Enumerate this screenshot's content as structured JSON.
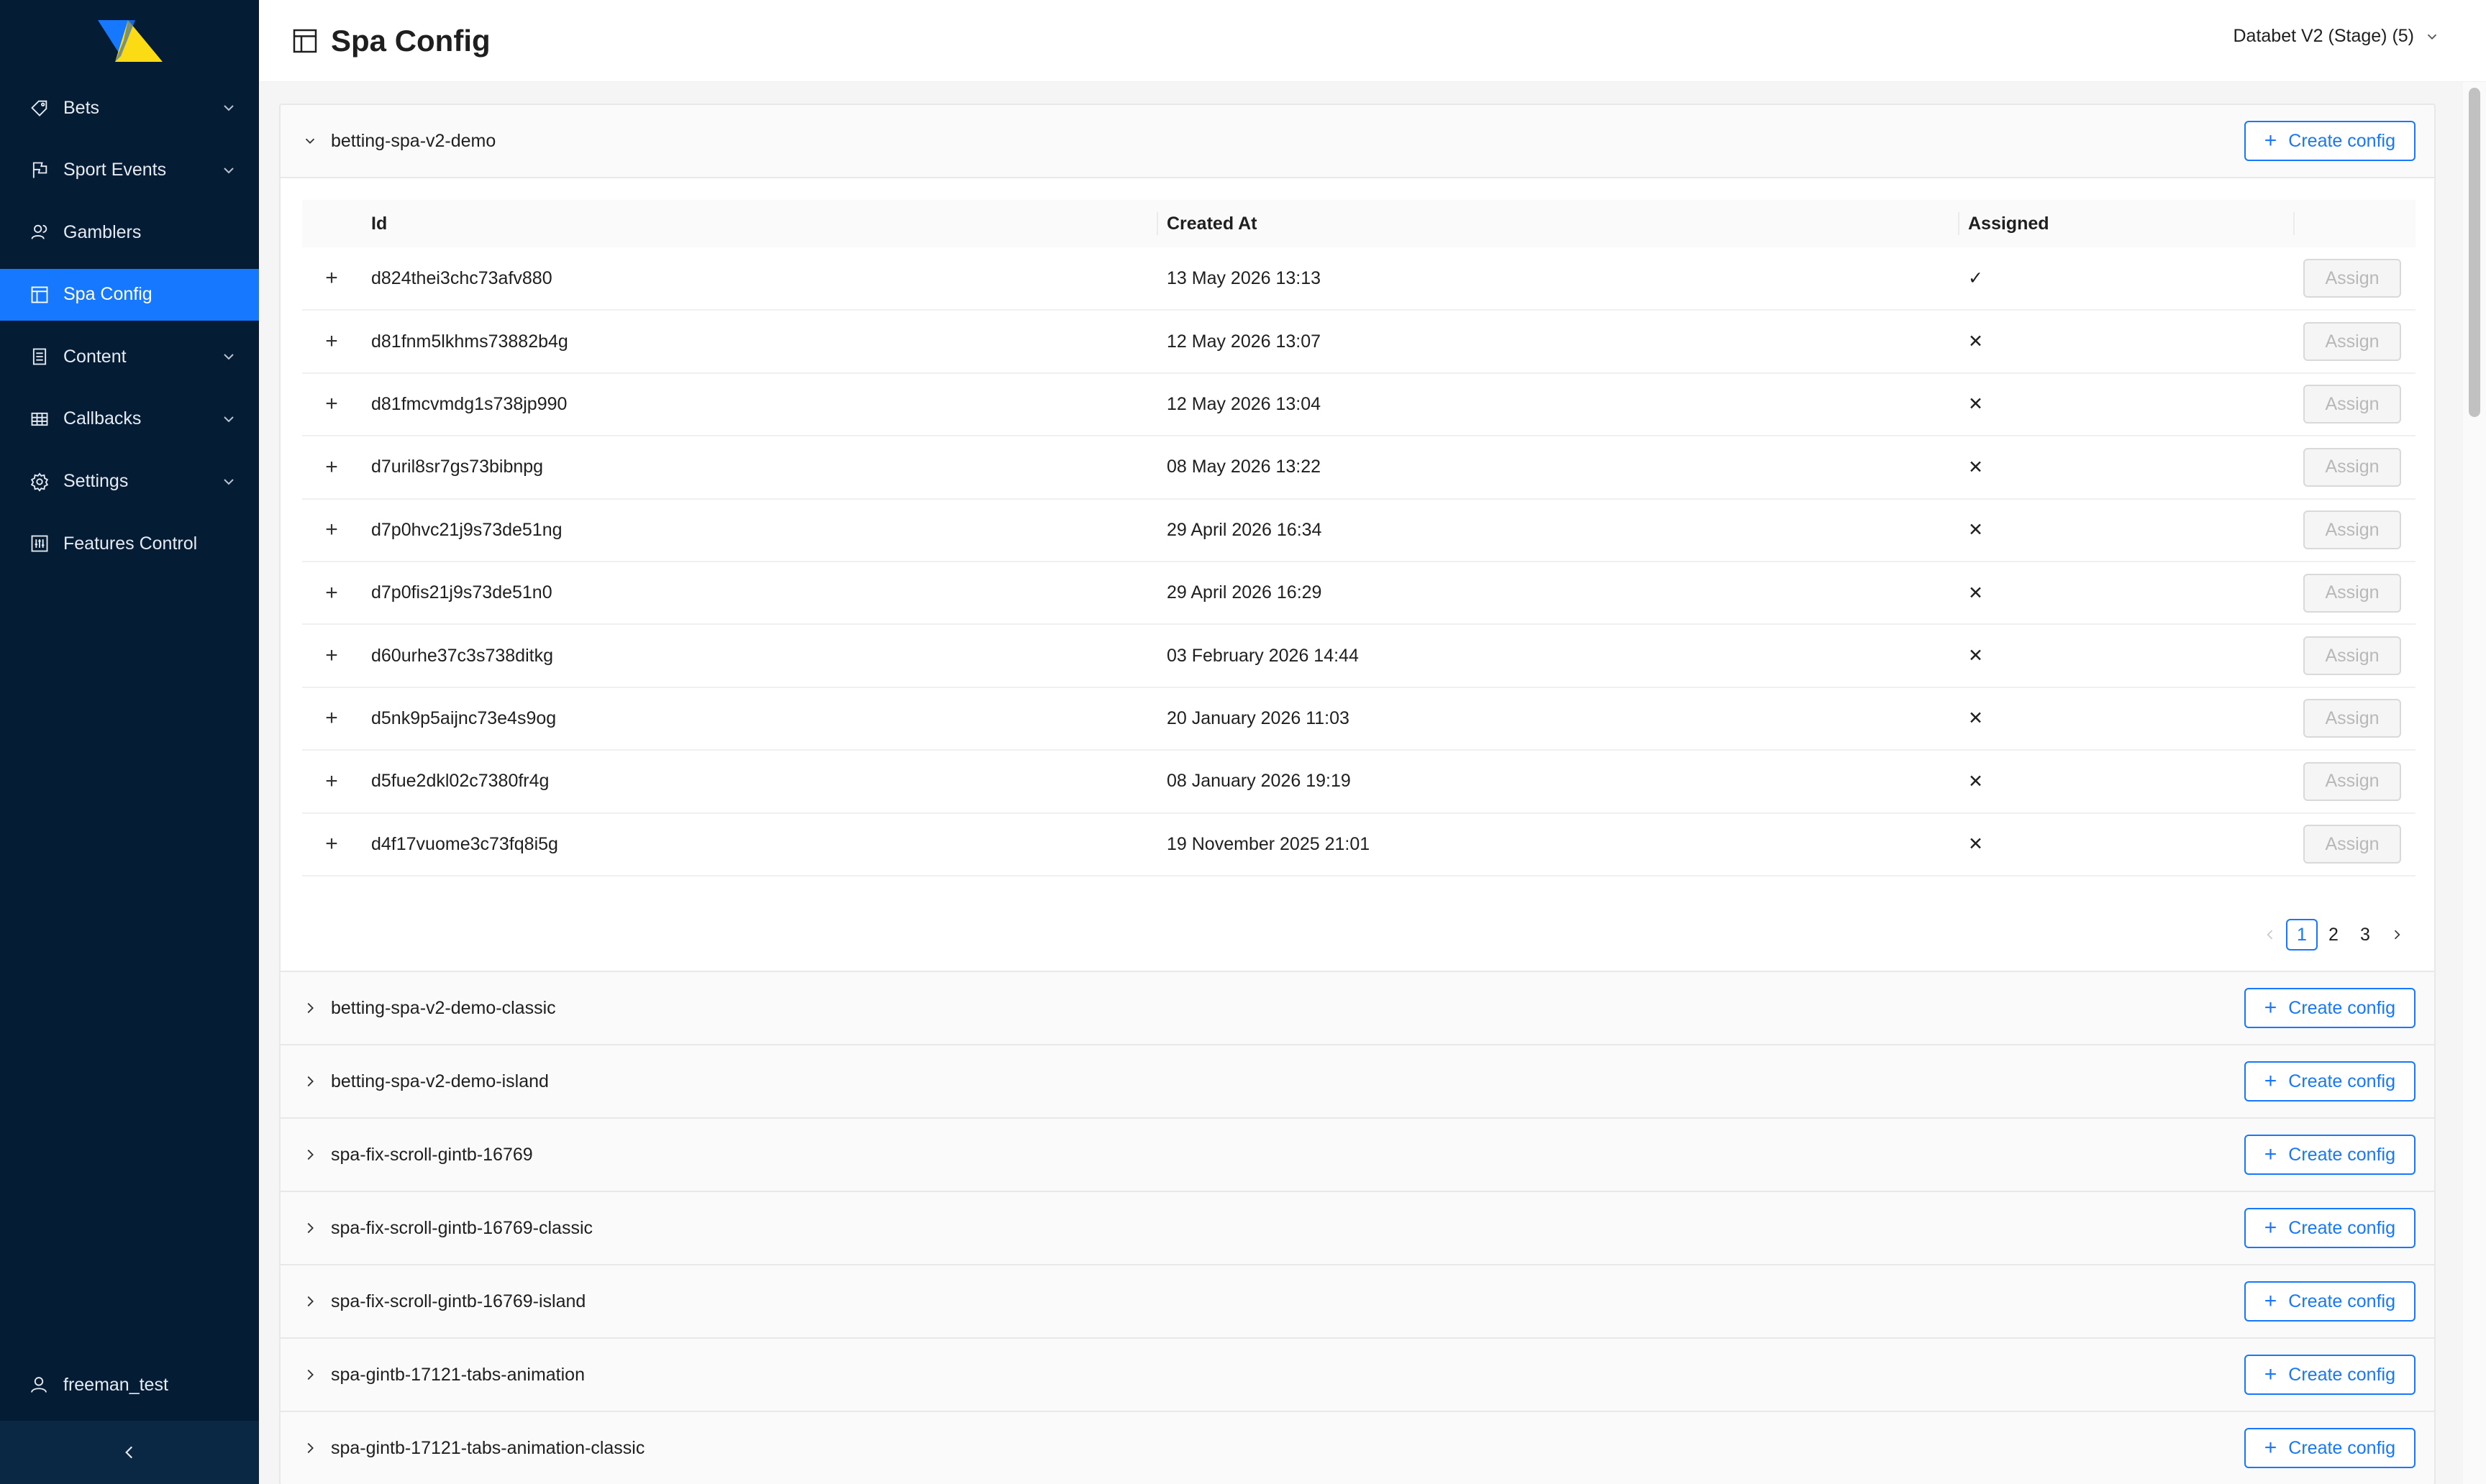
{
  "app": {
    "title": "Spa Config"
  },
  "sidebar": {
    "items": [
      {
        "label": "Bets",
        "icon": "tag-icon",
        "has_submenu": true,
        "active": false
      },
      {
        "label": "Sport Events",
        "icon": "flag-icon",
        "has_submenu": true,
        "active": false
      },
      {
        "label": "Gamblers",
        "icon": "users-icon",
        "has_submenu": false,
        "active": false
      },
      {
        "label": "Spa Config",
        "icon": "layout-icon",
        "has_submenu": false,
        "active": true
      },
      {
        "label": "Content",
        "icon": "document-icon",
        "has_submenu": true,
        "active": false
      },
      {
        "label": "Callbacks",
        "icon": "table-icon",
        "has_submenu": true,
        "active": false
      },
      {
        "label": "Settings",
        "icon": "gear-icon",
        "has_submenu": true,
        "active": false
      },
      {
        "label": "Features Control",
        "icon": "control-icon",
        "has_submenu": false,
        "active": false
      }
    ],
    "user": "freeman_test"
  },
  "header": {
    "title": "Spa Config",
    "project_select": "Databet V2 (Stage) (5)"
  },
  "colors": {
    "sidebar_bg": "#051c35",
    "accent": "#1677ff"
  },
  "create_label": "Create config",
  "assign_label": "Assign",
  "table": {
    "columns": [
      "Id",
      "Created At",
      "Assigned"
    ],
    "rows": [
      {
        "id": "d824thei3chc73afv880",
        "created_at": "13 May 2026 13:13",
        "assigned": "✓"
      },
      {
        "id": "d81fnm5lkhms73882b4g",
        "created_at": "12 May 2026 13:07",
        "assigned": "✕"
      },
      {
        "id": "d81fmcvmdg1s738jp990",
        "created_at": "12 May 2026 13:04",
        "assigned": "✕"
      },
      {
        "id": "d7uril8sr7gs73bibnpg",
        "created_at": "08 May 2026 13:22",
        "assigned": "✕"
      },
      {
        "id": "d7p0hvc21j9s73de51ng",
        "created_at": "29 April 2026 16:34",
        "assigned": "✕"
      },
      {
        "id": "d7p0fis21j9s73de51n0",
        "created_at": "29 April 2026 16:29",
        "assigned": "✕"
      },
      {
        "id": "d60urhe37c3s738ditkg",
        "created_at": "03 February 2026 14:44",
        "assigned": "✕"
      },
      {
        "id": "d5nk9p5aijnc73e4s9og",
        "created_at": "20 January 2026 11:03",
        "assigned": "✕"
      },
      {
        "id": "d5fue2dkl02c7380fr4g",
        "created_at": "08 January 2026 19:19",
        "assigned": "✕"
      },
      {
        "id": "d4f17vuome3c73fq8i5g",
        "created_at": "19 November 2025 21:01",
        "assigned": "✕"
      }
    ]
  },
  "pagination": {
    "pages": [
      "1",
      "2",
      "3"
    ],
    "current": "1"
  },
  "panels": [
    {
      "name": "betting-spa-v2-demo",
      "expanded": true
    },
    {
      "name": "betting-spa-v2-demo-classic",
      "expanded": false
    },
    {
      "name": "betting-spa-v2-demo-island",
      "expanded": false
    },
    {
      "name": "spa-fix-scroll-gintb-16769",
      "expanded": false
    },
    {
      "name": "spa-fix-scroll-gintb-16769-classic",
      "expanded": false
    },
    {
      "name": "spa-fix-scroll-gintb-16769-island",
      "expanded": false
    },
    {
      "name": "spa-gintb-17121-tabs-animation",
      "expanded": false
    },
    {
      "name": "spa-gintb-17121-tabs-animation-classic",
      "expanded": false
    }
  ]
}
